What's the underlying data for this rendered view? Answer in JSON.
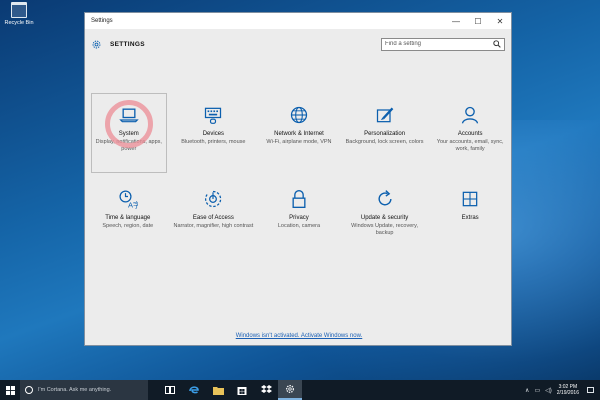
{
  "desktop": {
    "recycle_bin_label": "Recycle Bin"
  },
  "window": {
    "title": "Settings",
    "controls": {
      "minimize": "—",
      "maximize": "☐",
      "close": "✕"
    }
  },
  "header": {
    "heading": "SETTINGS",
    "search_placeholder": "Find a setting"
  },
  "categories": [
    {
      "name": "System",
      "desc": "Display, notifications, apps, power",
      "icon": "laptop-icon"
    },
    {
      "name": "Devices",
      "desc": "Bluetooth, printers, mouse",
      "icon": "keyboard-icon"
    },
    {
      "name": "Network & Internet",
      "desc": "Wi-Fi, airplane mode, VPN",
      "icon": "globe-icon"
    },
    {
      "name": "Personalization",
      "desc": "Background, lock screen, colors",
      "icon": "paint-icon"
    },
    {
      "name": "Accounts",
      "desc": "Your accounts, email, sync, work, family",
      "icon": "person-icon"
    },
    {
      "name": "Time & language",
      "desc": "Speech, region, date",
      "icon": "clock-language-icon"
    },
    {
      "name": "Ease of Access",
      "desc": "Narrator, magnifier, high contrast",
      "icon": "ease-of-access-icon"
    },
    {
      "name": "Privacy",
      "desc": "Location, camera",
      "icon": "lock-icon"
    },
    {
      "name": "Update & security",
      "desc": "Windows Update, recovery, backup",
      "icon": "refresh-icon"
    },
    {
      "name": "Extras",
      "desc": "",
      "icon": "extras-icon"
    }
  ],
  "activation_link": "Windows isn't activated. Activate Windows now.",
  "taskbar": {
    "search_text": "I'm Cortana. Ask me anything.",
    "clock_time": "3:02 PM",
    "clock_date": "2/19/2016"
  },
  "colors": {
    "accent": "#1a5fb4",
    "icon_blue": "#0b5fae",
    "highlight": "#ec8c96",
    "taskbar": "#101b26"
  }
}
